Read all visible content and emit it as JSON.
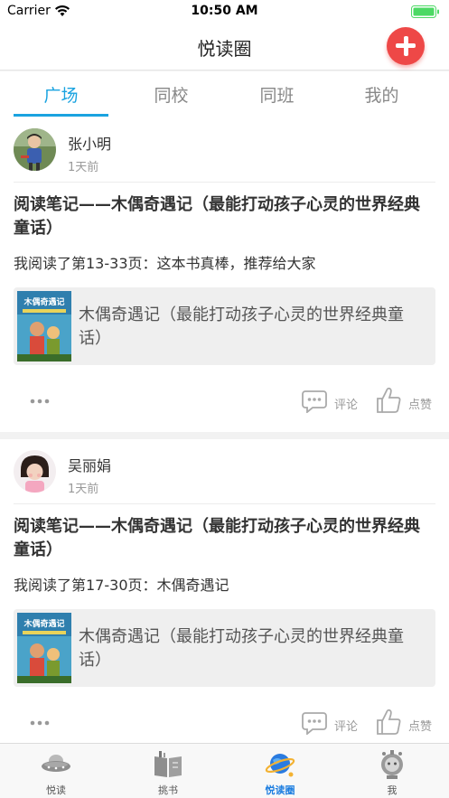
{
  "status_bar": {
    "carrier": "Carrier",
    "time": "10:50 AM"
  },
  "nav": {
    "title": "悦读圈",
    "add_icon": "plus-icon"
  },
  "tabs": [
    {
      "label": "广场",
      "active": true
    },
    {
      "label": "同校",
      "active": false
    },
    {
      "label": "同班",
      "active": false
    },
    {
      "label": "我的",
      "active": false
    }
  ],
  "posts": [
    {
      "author": "张小明",
      "time": "1天前",
      "title": "阅读笔记——木偶奇遇记（最能打动孩子心灵的世界经典童话）",
      "description": "我阅读了第13-33页：这本书真棒，推荐给大家",
      "book": {
        "title": "木偶奇遇记（最能打动孩子心灵的世界经典童话）"
      },
      "actions": {
        "comment": "评论",
        "like": "点赞"
      }
    },
    {
      "author": "吴丽娟",
      "time": "1天前",
      "title": "阅读笔记——木偶奇遇记（最能打动孩子心灵的世界经典童话）",
      "description": "我阅读了第17-30页：木偶奇遇记",
      "book": {
        "title": "木偶奇遇记（最能打动孩子心灵的世界经典童话）"
      },
      "actions": {
        "comment": "评论",
        "like": "点赞"
      }
    }
  ],
  "tab_bar": [
    {
      "label": "悦读",
      "icon": "ufo-icon",
      "active": false
    },
    {
      "label": "挑书",
      "icon": "book-icon",
      "active": false
    },
    {
      "label": "悦读圈",
      "icon": "planet-icon",
      "active": true
    },
    {
      "label": "我",
      "icon": "robot-icon",
      "active": false
    }
  ],
  "colors": {
    "accent": "#1aa3e0",
    "add_button": "#ee4847",
    "battery": "#4cd964"
  }
}
